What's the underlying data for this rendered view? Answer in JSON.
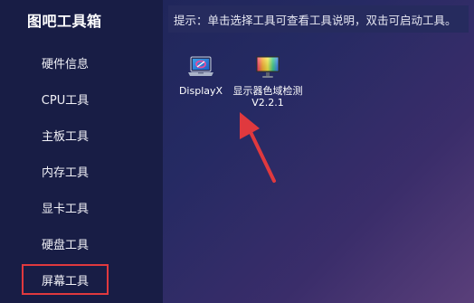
{
  "app": {
    "title": "图吧工具箱"
  },
  "sidebar": {
    "items": [
      {
        "label": "硬件信息"
      },
      {
        "label": "CPU工具"
      },
      {
        "label": "主板工具"
      },
      {
        "label": "内存工具"
      },
      {
        "label": "显卡工具"
      },
      {
        "label": "硬盘工具"
      },
      {
        "label": "屏幕工具",
        "selected": true
      }
    ],
    "highlight_color": "#e0393e"
  },
  "tip": {
    "text": "提示：单击选择工具可查看工具说明，双击可启动工具。"
  },
  "tools": [
    {
      "label": "DisplayX",
      "icon": "laptop-icon"
    },
    {
      "label": "显示器色域检测V2.2.1",
      "icon": "color-monitor-icon"
    }
  ],
  "annotation": {
    "arrow_color": "#e0393e"
  }
}
